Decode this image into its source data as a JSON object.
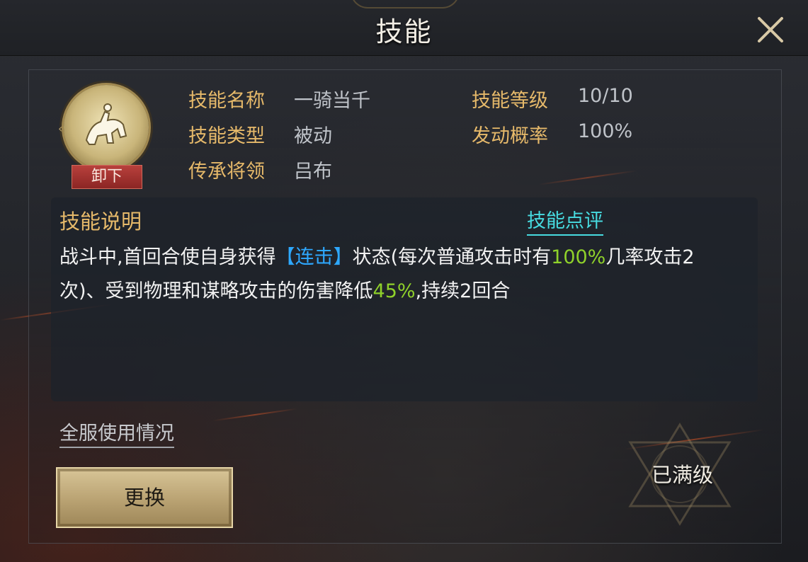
{
  "header": {
    "title": "技能"
  },
  "skill": {
    "unequip_label": "卸下",
    "fields": {
      "name_label": "技能名称",
      "name_value": "一骑当千",
      "level_label": "技能等级",
      "level_value": "10/10",
      "type_label": "技能类型",
      "type_value": "被动",
      "chance_label": "发动概率",
      "chance_value": "100%",
      "inherit_label": "传承将领",
      "inherit_value": "吕布"
    }
  },
  "description": {
    "title": "技能说明",
    "review_link": "技能点评",
    "parts": {
      "p1": "战斗中,首回合使自身获得",
      "kw1": "【连击】",
      "p2": "状态(每次普通攻击时有",
      "n1": "100%",
      "p3": "几率攻击2次)、受到物理和谋略攻击的伤害降低",
      "n2": "45%",
      "p4": ",持续2回合"
    }
  },
  "footer": {
    "usage_link": "全服使用情况",
    "replace_button": "更换",
    "max_level": "已满级"
  },
  "colors": {
    "label_gold": "#e6b96a",
    "value_gray": "#bfc3c9",
    "keyword_blue": "#2ea8ff",
    "number_green": "#8fd12a",
    "link_cyan": "#47dbe0",
    "unequip_red": "#8c2624"
  },
  "icons": {
    "close": "close-x-icon",
    "skill": "horse-rider-icon",
    "max_emblem": "star-emblem-icon"
  }
}
